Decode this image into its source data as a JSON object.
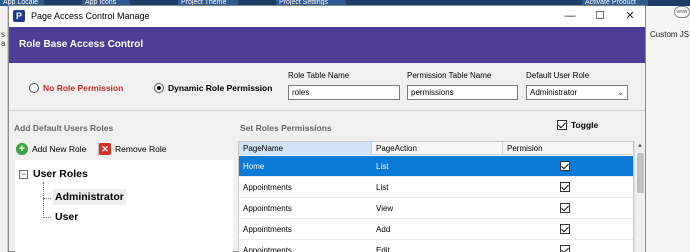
{
  "background": {
    "tabs": [
      "App Locale",
      "App Icons",
      "Project Theme",
      "Project Settings",
      "Activate Product"
    ],
    "left_text": "s a",
    "right_text": "Custom JS",
    "www_label": "www"
  },
  "window": {
    "title": "Page Access Control Manage",
    "minimize": "—",
    "maximize": "☐",
    "close": "✕"
  },
  "header": {
    "title": "Role Base Access Control"
  },
  "permission_mode": {
    "options": [
      {
        "label": "No Role Permission",
        "selected": false
      },
      {
        "label": "Dynamic Role Permission",
        "selected": true
      }
    ]
  },
  "fields": {
    "role_table": {
      "label": "Role Table Name",
      "value": "roles"
    },
    "permission_table": {
      "label": "Permission Table Name",
      "value": "permissions"
    },
    "default_role": {
      "label": "Default User Role",
      "value": "Administrator"
    }
  },
  "roles_panel": {
    "title": "Add Default Users Roles",
    "add_button": "Add New Role",
    "remove_button": "Remove Role",
    "tree": {
      "root": "User Roles",
      "items": [
        {
          "label": "Administrator",
          "selected": true
        },
        {
          "label": "User",
          "selected": false
        }
      ]
    }
  },
  "permissions_panel": {
    "title": "Set Roles Permissions",
    "toggle_label": "Toggle",
    "toggle_checked": true,
    "columns": [
      "PageName",
      "PageAction",
      "Permision"
    ],
    "rows": [
      {
        "page": "Home",
        "action": "List",
        "allowed": true,
        "selected": true
      },
      {
        "page": "Appointments",
        "action": "List",
        "allowed": true,
        "selected": false
      },
      {
        "page": "Appointments",
        "action": "View",
        "allowed": true,
        "selected": false
      },
      {
        "page": "Appointments",
        "action": "Add",
        "allowed": true,
        "selected": false
      },
      {
        "page": "Appointments",
        "action": "Edit",
        "allowed": true,
        "selected": false
      }
    ]
  },
  "colors": {
    "header_bg": "#4e3d95",
    "selected_row": "#0a7ad6",
    "no_role_red": "#c62828"
  }
}
